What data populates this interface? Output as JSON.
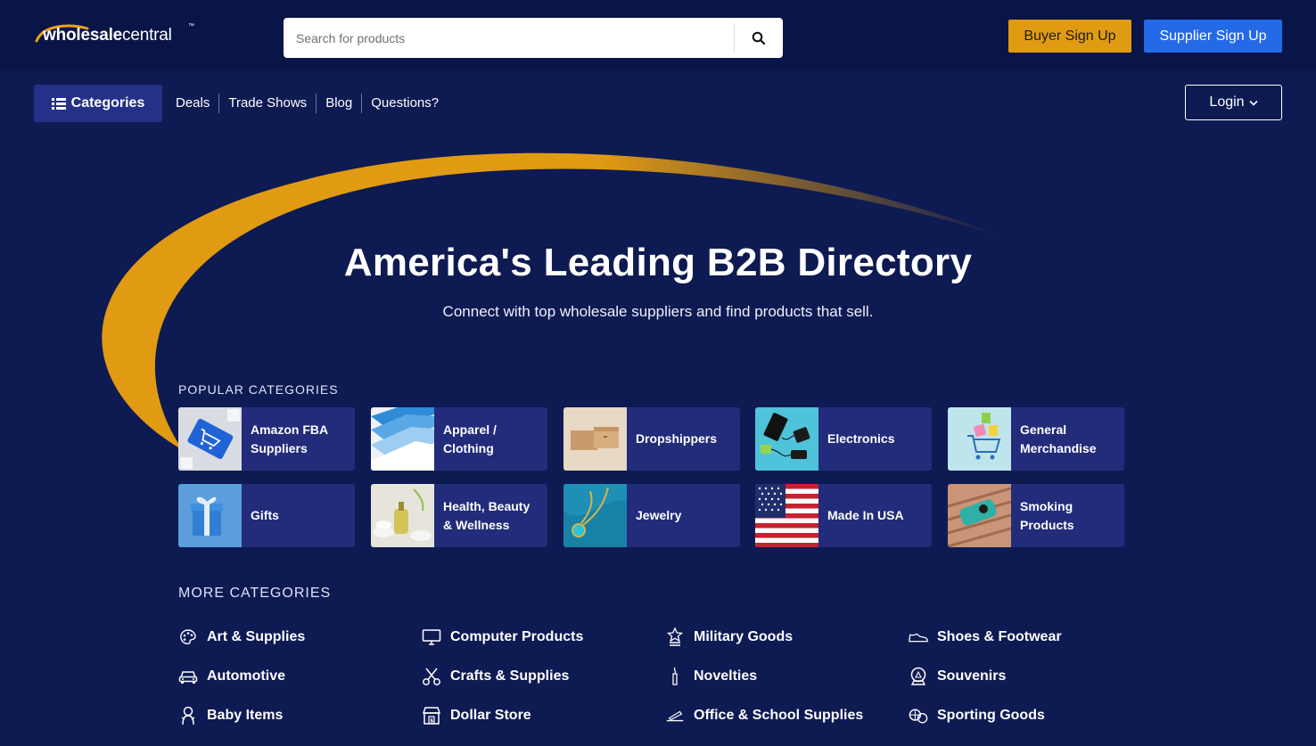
{
  "header": {
    "logo_text_bold": "wholesale",
    "logo_text_light": "central",
    "logo_tm": "™",
    "search_placeholder": "Search for products",
    "buyer_signup": "Buyer Sign Up",
    "supplier_signup": "Supplier Sign Up"
  },
  "nav": {
    "categories_label": "Categories",
    "links": [
      "Deals",
      "Trade Shows",
      "Blog",
      "Questions?"
    ],
    "login_label": "Login"
  },
  "hero": {
    "title": "America's Leading B2B Directory",
    "subtitle": "Connect with top wholesale suppliers and find products that sell."
  },
  "popular": {
    "heading": "POPULAR CATEGORIES",
    "items": [
      {
        "label_line1": "Amazon FBA",
        "label_line2": "Suppliers",
        "icon": "shopping-cart-keyboard"
      },
      {
        "label_line1": "Apparel /",
        "label_line2": "Clothing",
        "icon": "folded-shirts"
      },
      {
        "label_line1": "Dropshippers",
        "label_line2": "",
        "icon": "cardboard-boxes"
      },
      {
        "label_line1": "Electronics",
        "label_line2": "",
        "icon": "devices"
      },
      {
        "label_line1": "General",
        "label_line2": "Merchandise",
        "icon": "shopping-cart-bags"
      },
      {
        "label_line1": "Gifts",
        "label_line2": "",
        "icon": "gift-box"
      },
      {
        "label_line1": "Health, Beauty",
        "label_line2": "& Wellness",
        "icon": "spa-stones"
      },
      {
        "label_line1": "Jewelry",
        "label_line2": "",
        "icon": "pendant-necklace"
      },
      {
        "label_line1": "Made In USA",
        "label_line2": "",
        "icon": "us-flag"
      },
      {
        "label_line1": "Smoking",
        "label_line2": "Products",
        "icon": "vape-device"
      }
    ]
  },
  "more": {
    "heading": "MORE CATEGORIES",
    "items": [
      {
        "label": "Art & Supplies",
        "icon": "palette-icon"
      },
      {
        "label": "Automotive",
        "icon": "car-icon"
      },
      {
        "label": "Baby Items",
        "icon": "baby-icon"
      },
      {
        "label": "Computer Products",
        "icon": "monitor-icon"
      },
      {
        "label": "Crafts & Supplies",
        "icon": "scissors-icon"
      },
      {
        "label": "Dollar Store",
        "icon": "store-icon"
      },
      {
        "label": "Military Goods",
        "icon": "star-medal-icon"
      },
      {
        "label": "Novelties",
        "icon": "candle-icon"
      },
      {
        "label": "Office & School Supplies",
        "icon": "pen-icon"
      },
      {
        "label": "Shoes & Footwear",
        "icon": "shoe-icon"
      },
      {
        "label": "Souvenirs",
        "icon": "snow-globe-icon"
      },
      {
        "label": "Sporting Goods",
        "icon": "balls-icon"
      }
    ]
  },
  "colors": {
    "background": "#0e1a52",
    "topbar": "#091546",
    "tile": "#222c7a",
    "accent_orange": "#e19b12",
    "accent_blue": "#2369e8"
  }
}
